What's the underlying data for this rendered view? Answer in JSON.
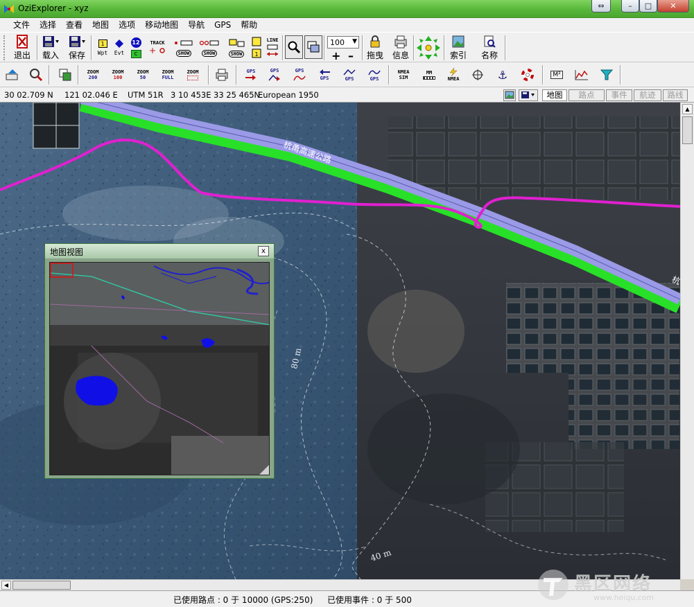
{
  "window": {
    "title": "OziExplorer - xyz",
    "buttons": {
      "back": "⇔",
      "minimize": "–",
      "maximize": "□",
      "close": "✕"
    }
  },
  "menu": [
    "文件",
    "选择",
    "查看",
    "地图",
    "选项",
    "移动地图",
    "导航",
    "GPS",
    "帮助"
  ],
  "toolbar": {
    "exit_label": "退出",
    "load_label": "载入",
    "save_label": "保存",
    "wpt_label": "Wpt",
    "evt_label": "Evt",
    "track_label": "TRACK",
    "show_label": "SHOW",
    "line_label": "LINE",
    "zoom_value": "100",
    "zoom_plus": "+",
    "zoom_minus": "–",
    "drag_label": "拖曳",
    "info_label": "信息",
    "index_label": "索引",
    "name_label": "名称",
    "wpt_num": "1",
    "evt_num": "12"
  },
  "toolbar2": {
    "zoom_buttons": [
      {
        "top": "ZOOM",
        "bottom": "200"
      },
      {
        "top": "ZOOM",
        "bottom": "100"
      },
      {
        "top": "ZOOM",
        "bottom": "50"
      },
      {
        "top": "ZOOM",
        "bottom": "FULL"
      },
      {
        "top": "ZOOM",
        "bottom": ""
      }
    ],
    "gps_label": "GPS",
    "nmea_sim_top": "NMEA",
    "nmea_sim_bottom": "SIM",
    "mm_top": "MM",
    "nmea_label": "NMEA",
    "m2_label": "M²"
  },
  "coords": {
    "lat": "30 02.709 N",
    "lon": "121 02.046 E",
    "utm": "UTM  51R",
    "easting": "3 10 453E",
    "northing": "33 25 465N",
    "datum": "European 1950"
  },
  "tabs": [
    "地图",
    "路点",
    "事件",
    "航迹",
    "路线"
  ],
  "map": {
    "highway_label": "杭甬高速公路",
    "highway_label_right": "杭",
    "contour_80": "80 m",
    "contour_40": "40 m"
  },
  "overview": {
    "title": "地图视图",
    "close": "x"
  },
  "status": {
    "waypoints": "已使用路点 : 0 于 10000   (GPS:250)",
    "events": "已使用事件 : 0 于 500"
  },
  "watermark": {
    "brand": "黑区网络",
    "url": "www.heiqu.com"
  },
  "colors": {
    "track": "#e020d0",
    "highway_fill": "#9a9ae6",
    "highway_border": "#28e028",
    "water": "#1010e6",
    "title_green": "#58b83a"
  }
}
